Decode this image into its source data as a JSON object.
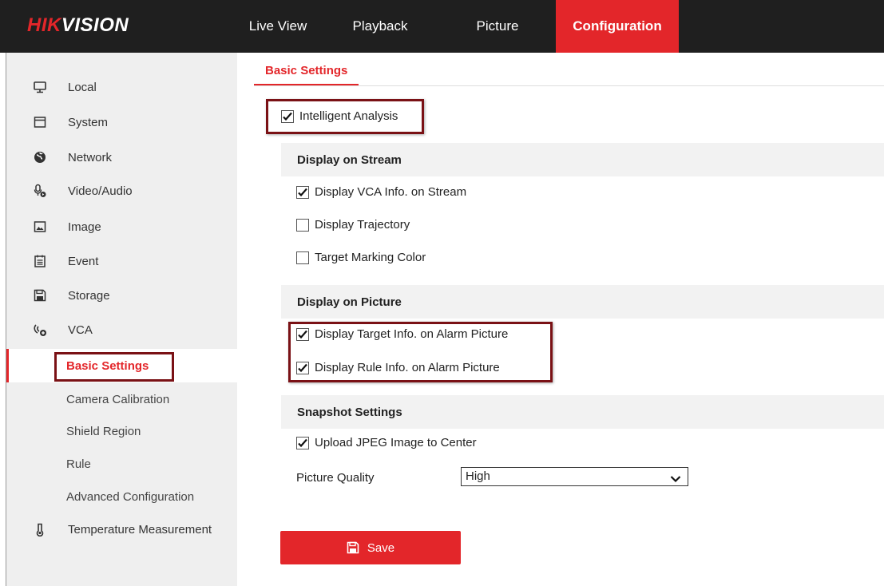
{
  "header": {
    "logo_red": "HIK",
    "logo_white": "VISION",
    "nav": {
      "live_view": "Live View",
      "playback": "Playback",
      "picture": "Picture",
      "configuration": "Configuration"
    }
  },
  "sidebar": {
    "items": [
      {
        "label": "Local",
        "icon": "monitor-icon"
      },
      {
        "label": "System",
        "icon": "window-icon"
      },
      {
        "label": "Network",
        "icon": "globe-icon"
      },
      {
        "label": "Video/Audio",
        "icon": "microphone-icon"
      },
      {
        "label": "Image",
        "icon": "image-icon"
      },
      {
        "label": "Event",
        "icon": "calendar-icon"
      },
      {
        "label": "Storage",
        "icon": "floppy-icon"
      },
      {
        "label": "VCA",
        "icon": "vca-icon"
      }
    ],
    "sub_items": {
      "basic_settings": "Basic Settings",
      "camera_calibration": "Camera Calibration",
      "shield_region": "Shield Region",
      "rule": "Rule",
      "advanced_configuration": "Advanced Configuration"
    },
    "temperature": {
      "label": "Temperature Measurement",
      "icon": "thermometer-icon"
    }
  },
  "main": {
    "tab": "Basic Settings",
    "intelligent_analysis": {
      "label": "Intelligent Analysis",
      "checked": true
    },
    "display_on_stream": {
      "title": "Display on Stream",
      "vca_info": {
        "label": "Display VCA Info. on Stream",
        "checked": true
      },
      "trajectory": {
        "label": "Display Trajectory",
        "checked": false
      },
      "target_marking": {
        "label": "Target Marking Color",
        "checked": false
      }
    },
    "display_on_picture": {
      "title": "Display on Picture",
      "target_info": {
        "label": "Display Target Info. on Alarm Picture",
        "checked": true
      },
      "rule_info": {
        "label": "Display Rule Info. on Alarm Picture",
        "checked": true
      }
    },
    "snapshot_settings": {
      "title": "Snapshot Settings",
      "upload_jpeg": {
        "label": "Upload JPEG Image to Center",
        "checked": true
      },
      "picture_quality_label": "Picture Quality",
      "picture_quality_value": "High"
    },
    "save_label": "Save"
  },
  "colors": {
    "accent": "#e3262a",
    "topbar": "#1f1f1f",
    "highlight_box": "#7a1115",
    "sidebar_bg": "#efefef"
  }
}
